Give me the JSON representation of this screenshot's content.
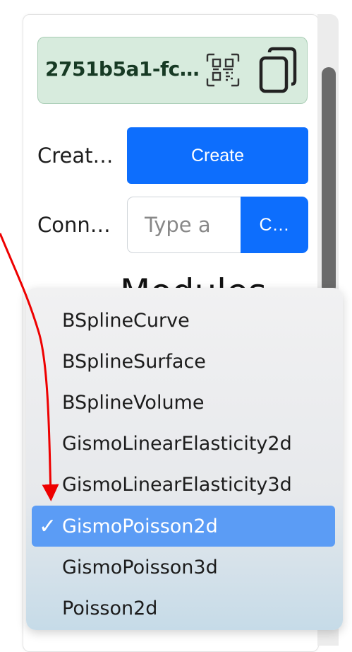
{
  "session": {
    "id_text": "2751b5a1-fc…",
    "qr_icon": "qr-code-icon",
    "copy_icon": "copy-icon"
  },
  "create_row": {
    "label": "Creat…",
    "button_label": "Create"
  },
  "connect_row": {
    "label": "Conn…",
    "input_placeholder": "Type a",
    "button_label": "C…"
  },
  "partial_heading": "Modules",
  "dropdown": {
    "options": [
      "BSplineCurve",
      "BSplineSurface",
      "BSplineVolume",
      "GismoLinearElasticity2d",
      "GismoLinearElasticity3d",
      "GismoPoisson2d",
      "GismoPoisson3d",
      "Poisson2d"
    ],
    "selected_index": 5,
    "selected_mark": "✓"
  },
  "colors": {
    "primary_button": "#0d6efd",
    "selected_option": "#5b9cf5",
    "session_box": "#d7ebdd",
    "annotation_arrow": "#ee0000"
  }
}
